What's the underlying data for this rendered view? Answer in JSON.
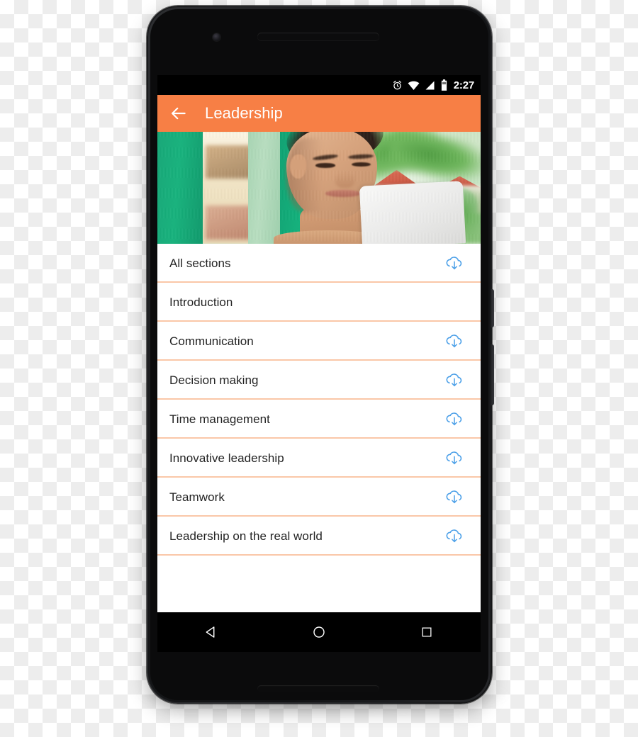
{
  "device": {
    "name": "android-smartphone",
    "hardware": {
      "earpiece": "earpiece-speaker",
      "front_camera": "front-camera",
      "bottom_speaker": "bottom-speaker",
      "power_button": "power-button",
      "volume_button": "volume-button"
    }
  },
  "status_bar": {
    "time": "2:27",
    "icons": [
      "alarm-icon",
      "wifi-icon",
      "cellular-signal-icon",
      "battery-icon"
    ]
  },
  "app_bar": {
    "back_icon": "back-arrow-icon",
    "title": "Leadership",
    "background_color": "#F77F45",
    "title_color": "#FFFFFF"
  },
  "hero": {
    "alt": "woman-with-laptop-against-green-wall"
  },
  "list": {
    "divider_color": "#FAC7A8",
    "download_icon_color": "#4A9FE8",
    "items": [
      {
        "label": "All sections",
        "downloadable": true
      },
      {
        "label": "Introduction",
        "downloadable": false
      },
      {
        "label": "Communication",
        "downloadable": true
      },
      {
        "label": "Decision making",
        "downloadable": true
      },
      {
        "label": "Time management",
        "downloadable": true
      },
      {
        "label": "Innovative leadership",
        "downloadable": true
      },
      {
        "label": "Teamwork",
        "downloadable": true
      },
      {
        "label": "Leadership on the real world",
        "downloadable": true
      }
    ]
  },
  "nav_bar": {
    "back": "nav-back-icon",
    "home": "nav-home-icon",
    "recents": "nav-recents-icon"
  }
}
